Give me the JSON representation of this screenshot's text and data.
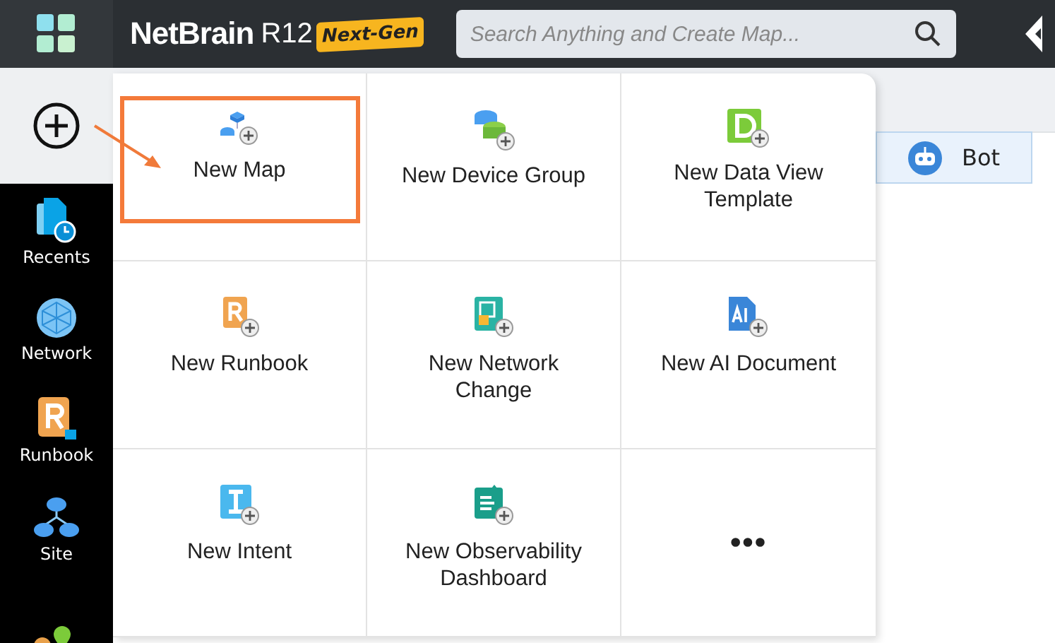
{
  "top_bar": {
    "logo": "NetBrain",
    "version": "R12",
    "badge": "Next-Gen",
    "search": {
      "placeholder": "Search Anything and Create Map..."
    }
  },
  "sidebar": {
    "items": [
      {
        "label": "Recents",
        "kind": "recents"
      },
      {
        "label": "Network",
        "kind": "network"
      },
      {
        "label": "Runbook",
        "kind": "runbook"
      },
      {
        "label": "Site",
        "kind": "site"
      }
    ]
  },
  "create_menu": {
    "items": [
      {
        "label": "New Map",
        "kind": "map",
        "highlighted": true
      },
      {
        "label": "New Device Group",
        "kind": "device-group",
        "highlighted": false
      },
      {
        "label": "New Data View Template",
        "kind": "data-view",
        "highlighted": false
      },
      {
        "label": "New Runbook",
        "kind": "runbook",
        "highlighted": false
      },
      {
        "label": "New Network Change",
        "kind": "change",
        "highlighted": false
      },
      {
        "label": "New AI Document",
        "kind": "ai",
        "highlighted": false
      },
      {
        "label": "New Intent",
        "kind": "intent",
        "highlighted": false
      },
      {
        "label": "New Observability Dashboard",
        "kind": "dashboard",
        "highlighted": false
      },
      {
        "label": "•••",
        "kind": "more",
        "highlighted": false
      }
    ]
  },
  "bot_button": {
    "label": "Bot"
  }
}
